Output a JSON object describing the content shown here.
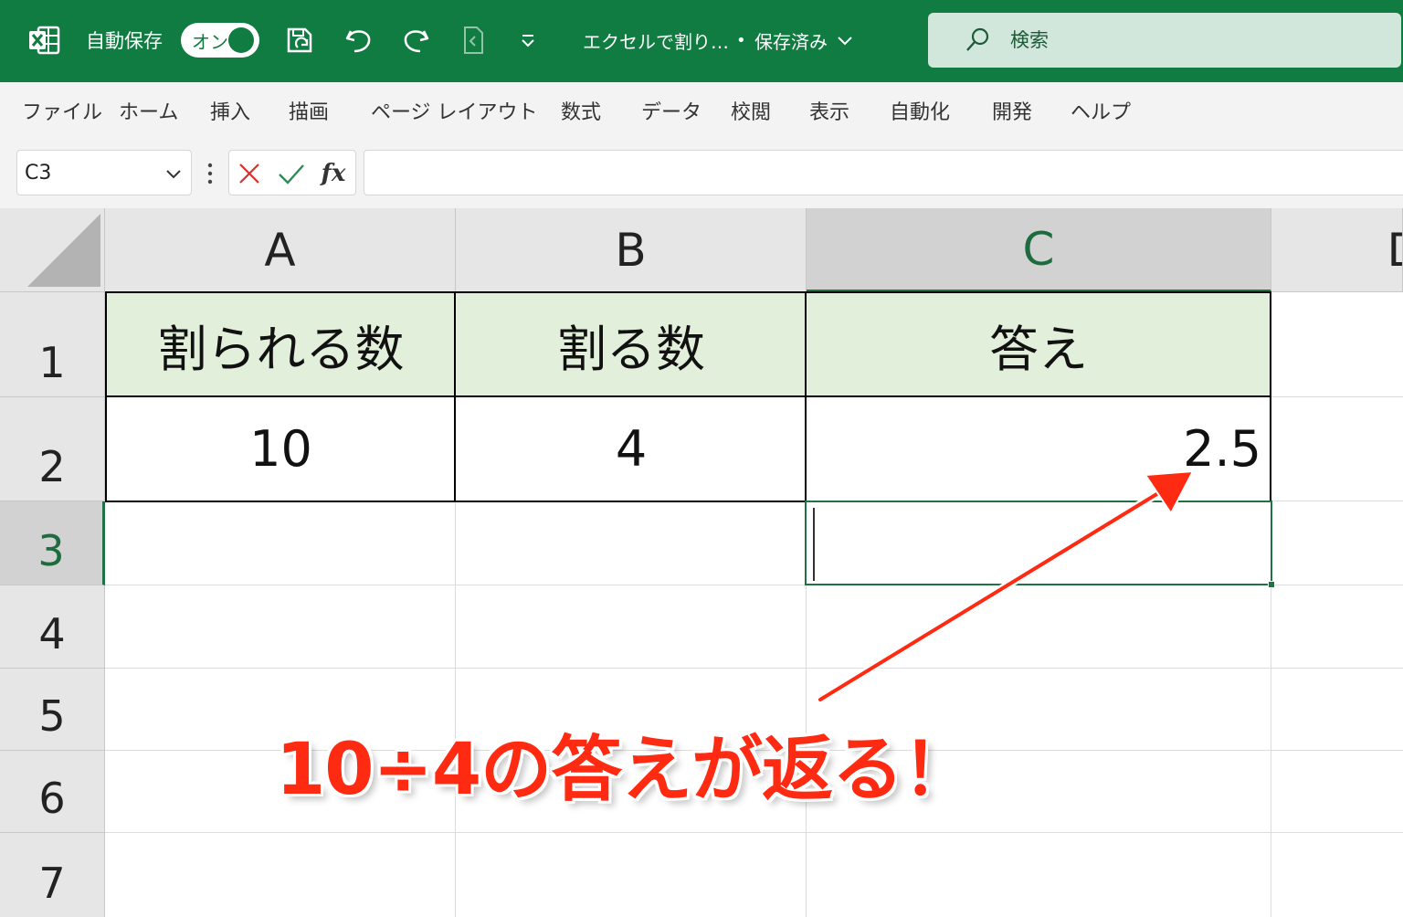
{
  "titlebar": {
    "autosave_label": "自動保存",
    "autosave_state": "オン",
    "doc_title": "エクセルで割り…",
    "doc_separator": "•",
    "save_status": "保存済み",
    "search_placeholder": "検索",
    "accent_color": "#107c41"
  },
  "ribbon_tabs": [
    "ファイル",
    "ホーム",
    "挿入",
    "描画",
    "ページ レイアウト",
    "数式",
    "データ",
    "校閲",
    "表示",
    "自動化",
    "開発",
    "ヘルプ"
  ],
  "formula_bar": {
    "name_box": "C3",
    "fx_label": "fx",
    "formula": ""
  },
  "sheet": {
    "columns": [
      "A",
      "B",
      "C",
      "D"
    ],
    "rows": [
      "1",
      "2",
      "3",
      "4",
      "5",
      "6",
      "7"
    ],
    "selected_cell": "C3",
    "cells": {
      "A1": "割られる数",
      "B1": "割る数",
      "C1": "答え",
      "A2": "10",
      "B2": "4",
      "C2": "2.5"
    },
    "header_fill": "#e2efda"
  },
  "annotation": {
    "text": "10÷4の答えが返る！",
    "color": "#ff2a12"
  }
}
